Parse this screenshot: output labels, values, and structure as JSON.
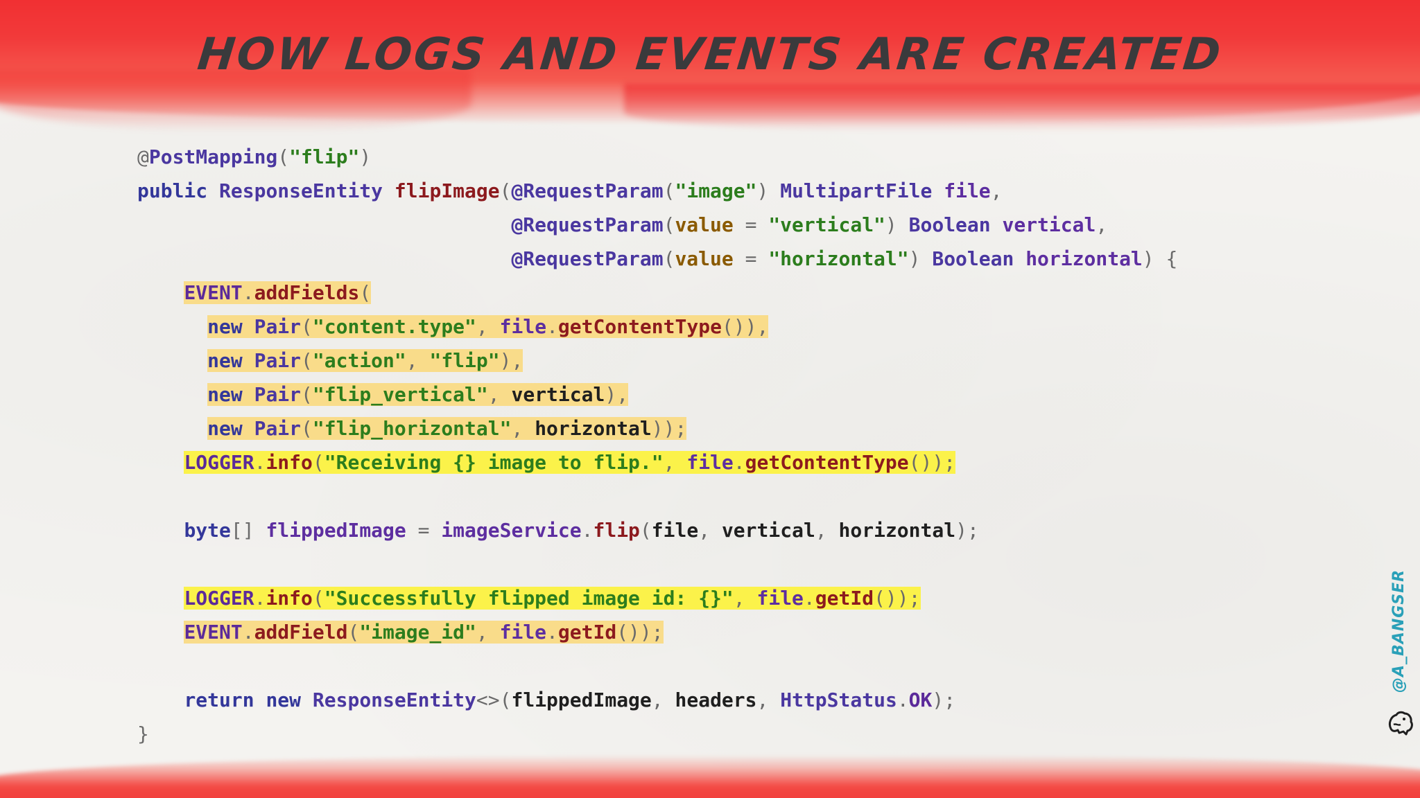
{
  "title": "How logs and events are created",
  "handle": "@A_BANGSER",
  "code": [
    {
      "indent": "",
      "hl": "",
      "tokens": [
        {
          "t": "@",
          "c": "pu"
        },
        {
          "t": "PostMapping",
          "c": "an"
        },
        {
          "t": "(",
          "c": "pu"
        },
        {
          "t": "\"flip\"",
          "c": "st"
        },
        {
          "t": ")",
          "c": "pu"
        }
      ]
    },
    {
      "indent": "",
      "hl": "",
      "tokens": [
        {
          "t": "public ",
          "c": "kw"
        },
        {
          "t": "ResponseEntity ",
          "c": "ty"
        },
        {
          "t": "flipImage",
          "c": "me"
        },
        {
          "t": "(",
          "c": "pu"
        },
        {
          "t": "@RequestParam",
          "c": "an"
        },
        {
          "t": "(",
          "c": "pu"
        },
        {
          "t": "\"image\"",
          "c": "st"
        },
        {
          "t": ") ",
          "c": "pu"
        },
        {
          "t": "MultipartFile ",
          "c": "ty"
        },
        {
          "t": "file",
          "c": "cf"
        },
        {
          "t": ",",
          "c": "pu"
        }
      ]
    },
    {
      "indent": "                                ",
      "hl": "",
      "tokens": [
        {
          "t": "@RequestParam",
          "c": "an"
        },
        {
          "t": "(",
          "c": "pu"
        },
        {
          "t": "value",
          "c": "pr"
        },
        {
          "t": " = ",
          "c": "pu"
        },
        {
          "t": "\"vertical\"",
          "c": "st"
        },
        {
          "t": ") ",
          "c": "pu"
        },
        {
          "t": "Boolean ",
          "c": "ty"
        },
        {
          "t": "vertical",
          "c": "cf"
        },
        {
          "t": ",",
          "c": "pu"
        }
      ]
    },
    {
      "indent": "                                ",
      "hl": "",
      "tokens": [
        {
          "t": "@RequestParam",
          "c": "an"
        },
        {
          "t": "(",
          "c": "pu"
        },
        {
          "t": "value",
          "c": "pr"
        },
        {
          "t": " = ",
          "c": "pu"
        },
        {
          "t": "\"horizontal\"",
          "c": "st"
        },
        {
          "t": ") ",
          "c": "pu"
        },
        {
          "t": "Boolean ",
          "c": "ty"
        },
        {
          "t": "horizontal",
          "c": "cf"
        },
        {
          "t": ") {",
          "c": "pu"
        }
      ]
    },
    {
      "indent": "    ",
      "hl": "hl-o",
      "tokens": [
        {
          "t": "EVENT",
          "c": "fd"
        },
        {
          "t": ".",
          "c": "pu"
        },
        {
          "t": "addFields",
          "c": "me"
        },
        {
          "t": "(",
          "c": "pu"
        }
      ]
    },
    {
      "indent": "      ",
      "hl": "hl-o",
      "tokens": [
        {
          "t": "new ",
          "c": "kw"
        },
        {
          "t": "Pair",
          "c": "ty"
        },
        {
          "t": "(",
          "c": "pu"
        },
        {
          "t": "\"content.type\"",
          "c": "st"
        },
        {
          "t": ", ",
          "c": "pu"
        },
        {
          "t": "file",
          "c": "cf"
        },
        {
          "t": ".",
          "c": "pu"
        },
        {
          "t": "getContentType",
          "c": "me"
        },
        {
          "t": "()),",
          "c": "pu"
        }
      ]
    },
    {
      "indent": "      ",
      "hl": "hl-o",
      "tokens": [
        {
          "t": "new ",
          "c": "kw"
        },
        {
          "t": "Pair",
          "c": "ty"
        },
        {
          "t": "(",
          "c": "pu"
        },
        {
          "t": "\"action\"",
          "c": "st"
        },
        {
          "t": ", ",
          "c": "pu"
        },
        {
          "t": "\"flip\"",
          "c": "st"
        },
        {
          "t": "),",
          "c": "pu"
        }
      ]
    },
    {
      "indent": "      ",
      "hl": "hl-o",
      "tokens": [
        {
          "t": "new ",
          "c": "kw"
        },
        {
          "t": "Pair",
          "c": "ty"
        },
        {
          "t": "(",
          "c": "pu"
        },
        {
          "t": "\"flip_vertical\"",
          "c": "st"
        },
        {
          "t": ", ",
          "c": "pu"
        },
        {
          "t": "vertical",
          "c": "pl"
        },
        {
          "t": "),",
          "c": "pu"
        }
      ]
    },
    {
      "indent": "      ",
      "hl": "hl-o",
      "tokens": [
        {
          "t": "new ",
          "c": "kw"
        },
        {
          "t": "Pair",
          "c": "ty"
        },
        {
          "t": "(",
          "c": "pu"
        },
        {
          "t": "\"flip_horizontal\"",
          "c": "st"
        },
        {
          "t": ", ",
          "c": "pu"
        },
        {
          "t": "horizontal",
          "c": "pl"
        },
        {
          "t": "));",
          "c": "pu"
        }
      ]
    },
    {
      "indent": "    ",
      "hl": "hl-y",
      "tokens": [
        {
          "t": "LOGGER",
          "c": "fd"
        },
        {
          "t": ".",
          "c": "pu"
        },
        {
          "t": "info",
          "c": "me"
        },
        {
          "t": "(",
          "c": "pu"
        },
        {
          "t": "\"Receiving {} image to flip.\"",
          "c": "st"
        },
        {
          "t": ", ",
          "c": "pu"
        },
        {
          "t": "file",
          "c": "cf"
        },
        {
          "t": ".",
          "c": "pu"
        },
        {
          "t": "getContentType",
          "c": "me"
        },
        {
          "t": "());",
          "c": "pu"
        }
      ]
    },
    {
      "indent": "",
      "hl": "",
      "tokens": []
    },
    {
      "indent": "    ",
      "hl": "",
      "tokens": [
        {
          "t": "byte",
          "c": "kw"
        },
        {
          "t": "[] ",
          "c": "pu"
        },
        {
          "t": "flippedImage",
          "c": "cf"
        },
        {
          "t": " = ",
          "c": "pu"
        },
        {
          "t": "imageService",
          "c": "cf"
        },
        {
          "t": ".",
          "c": "pu"
        },
        {
          "t": "flip",
          "c": "me"
        },
        {
          "t": "(",
          "c": "pu"
        },
        {
          "t": "file",
          "c": "pl"
        },
        {
          "t": ", ",
          "c": "pu"
        },
        {
          "t": "vertical",
          "c": "pl"
        },
        {
          "t": ", ",
          "c": "pu"
        },
        {
          "t": "horizontal",
          "c": "pl"
        },
        {
          "t": ");",
          "c": "pu"
        }
      ]
    },
    {
      "indent": "",
      "hl": "",
      "tokens": []
    },
    {
      "indent": "    ",
      "hl": "hl-y",
      "tokens": [
        {
          "t": "LOGGER",
          "c": "fd"
        },
        {
          "t": ".",
          "c": "pu"
        },
        {
          "t": "info",
          "c": "me"
        },
        {
          "t": "(",
          "c": "pu"
        },
        {
          "t": "\"Successfully flipped image id: {}\"",
          "c": "st"
        },
        {
          "t": ", ",
          "c": "pu"
        },
        {
          "t": "file",
          "c": "cf"
        },
        {
          "t": ".",
          "c": "pu"
        },
        {
          "t": "getId",
          "c": "me"
        },
        {
          "t": "());",
          "c": "pu"
        }
      ]
    },
    {
      "indent": "    ",
      "hl": "hl-o",
      "tokens": [
        {
          "t": "EVENT",
          "c": "fd"
        },
        {
          "t": ".",
          "c": "pu"
        },
        {
          "t": "addField",
          "c": "me"
        },
        {
          "t": "(",
          "c": "pu"
        },
        {
          "t": "\"image_id\"",
          "c": "st"
        },
        {
          "t": ", ",
          "c": "pu"
        },
        {
          "t": "file",
          "c": "cf"
        },
        {
          "t": ".",
          "c": "pu"
        },
        {
          "t": "getId",
          "c": "me"
        },
        {
          "t": "());",
          "c": "pu"
        }
      ]
    },
    {
      "indent": "",
      "hl": "",
      "tokens": []
    },
    {
      "indent": "    ",
      "hl": "",
      "tokens": [
        {
          "t": "return ",
          "c": "kw"
        },
        {
          "t": "new ",
          "c": "kw"
        },
        {
          "t": "ResponseEntity",
          "c": "ty"
        },
        {
          "t": "<>(",
          "c": "pu"
        },
        {
          "t": "flippedImage",
          "c": "pl"
        },
        {
          "t": ", ",
          "c": "pu"
        },
        {
          "t": "headers",
          "c": "pl"
        },
        {
          "t": ", ",
          "c": "pu"
        },
        {
          "t": "HttpStatus",
          "c": "ty"
        },
        {
          "t": ".",
          "c": "pu"
        },
        {
          "t": "OK",
          "c": "fd"
        },
        {
          "t": ");",
          "c": "pu"
        }
      ]
    },
    {
      "indent": "",
      "hl": "",
      "tokens": [
        {
          "t": "}",
          "c": "pu"
        }
      ]
    }
  ]
}
